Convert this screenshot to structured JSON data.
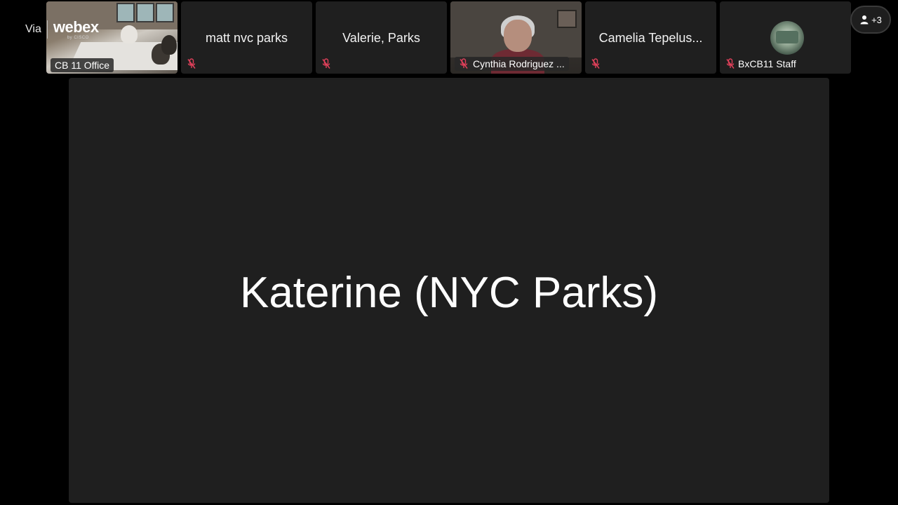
{
  "branding": {
    "via": "Via",
    "product": "webex",
    "by": "by CISCO"
  },
  "overflow": {
    "label": "+3"
  },
  "tiles": [
    {
      "name": "CB 11 Office",
      "type": "video",
      "muted": false
    },
    {
      "name": "matt nvc parks",
      "type": "name",
      "muted": true
    },
    {
      "name": "Valerie, Parks",
      "type": "name",
      "muted": true
    },
    {
      "name": "Cynthia Rodriguez ...",
      "type": "video",
      "muted": true
    },
    {
      "name": "Camelia Tepelus...",
      "type": "name",
      "muted": true
    },
    {
      "name": "BxCB11 Staff",
      "type": "avatar",
      "muted": true
    }
  ],
  "main": {
    "speaker_name": "Katerine (NYC Parks)"
  },
  "colors": {
    "background": "#000000",
    "tile": "#1f1f1f",
    "muted_icon": "#e0405a"
  }
}
